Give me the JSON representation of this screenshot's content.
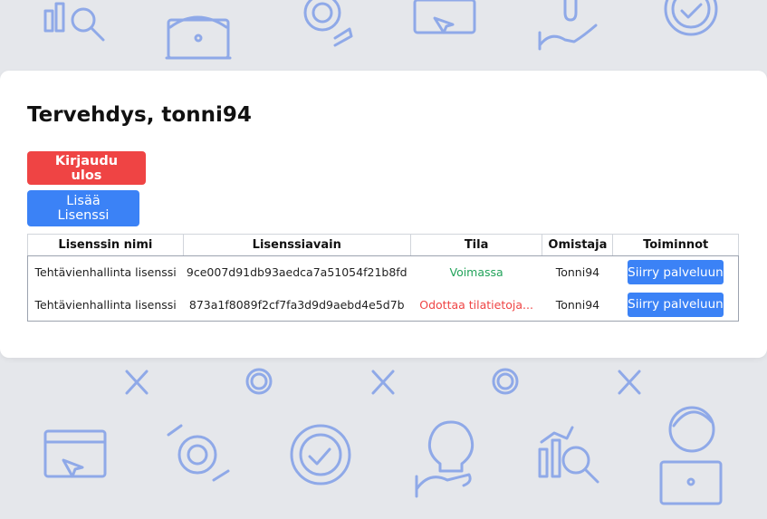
{
  "greeting": "Tervehdys, tonni94",
  "buttons": {
    "logout": "Kirjaudu ulos",
    "add_license": "Lisää Lisenssi"
  },
  "table": {
    "headers": [
      "Lisenssin nimi",
      "Lisenssiavain",
      "Tila",
      "Omistaja",
      "Toiminnot"
    ],
    "rows": [
      {
        "name": "Tehtävienhallinta lisenssi",
        "key": "9ce007d91db93aedca7a51054f21b8fd",
        "status": "Voimassa",
        "owner": "Tonni94",
        "action": "Siirry palveluun"
      },
      {
        "name": "Tehtävienhallinta lisenssi",
        "key": "873a1f8089f2cf7fa3d9d9aebd4e5d7b",
        "status": "Odottaa tilatietoja...",
        "owner": "Tonni94",
        "action": "Siirry palveluun"
      }
    ]
  },
  "colors": {
    "background": "#e5e7eb",
    "icon": "#8fa9e8",
    "danger": "#ef4444",
    "primary": "#3b82f6",
    "success": "#22a35a"
  },
  "background_icons": [
    "analytics-search-icon",
    "person-laptop-icon",
    "gear-hand-icon",
    "www-browser-icon",
    "lightbulb-hand-icon",
    "gear-check-icon",
    "tools-icon",
    "gear-icon"
  ]
}
